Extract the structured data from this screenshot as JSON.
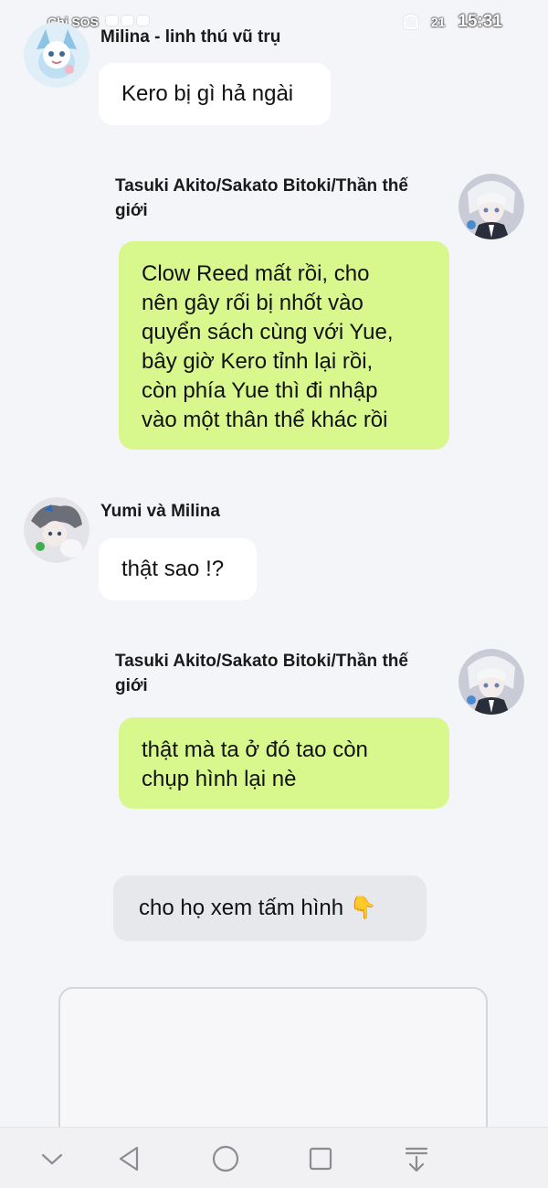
{
  "status_bar": {
    "carrier": "Chỉ SOS",
    "battery": "21",
    "time": "15:31"
  },
  "messages": [
    {
      "sender": "Milina - linh thú vũ trụ",
      "text": "Kero bị gì hả ngài"
    },
    {
      "sender": "Tasuki Akito/Sakato Bitoki/Thần thế giới",
      "lines": [
        "Clow Reed mất rồi, cho",
        "nên gây rối bị nhốt vào",
        "quyển sách cùng với Yue,",
        "bây giờ Kero tỉnh lại rồi,",
        "còn phía Yue thì đi nhập",
        "vào một thân thể khác rồi"
      ]
    },
    {
      "sender": "Yumi và Milina",
      "text": "thật sao !?"
    },
    {
      "sender": "Tasuki Akito/Sakato Bitoki/Thần thế giới",
      "lines": [
        "thật mà ta ở đó tao còn",
        "chụp hình lại nè"
      ]
    },
    {
      "text": "cho họ xem tấm hình 👇"
    }
  ],
  "sender_name_lines": {
    "tasuki_line1": "Tasuki Akito/Sakato Bitoki/Thần thế",
    "tasuki_line2": "giới"
  },
  "icons": {
    "nav": [
      "chevron-down-icon",
      "back-icon",
      "home-icon",
      "recents-icon",
      "download-icon"
    ]
  },
  "colors": {
    "background": "#f4f5f9",
    "incoming_bubble": "#ffffff",
    "outgoing_bubble": "#d8f88e",
    "narrator_bubble": "#e7e8ec"
  }
}
